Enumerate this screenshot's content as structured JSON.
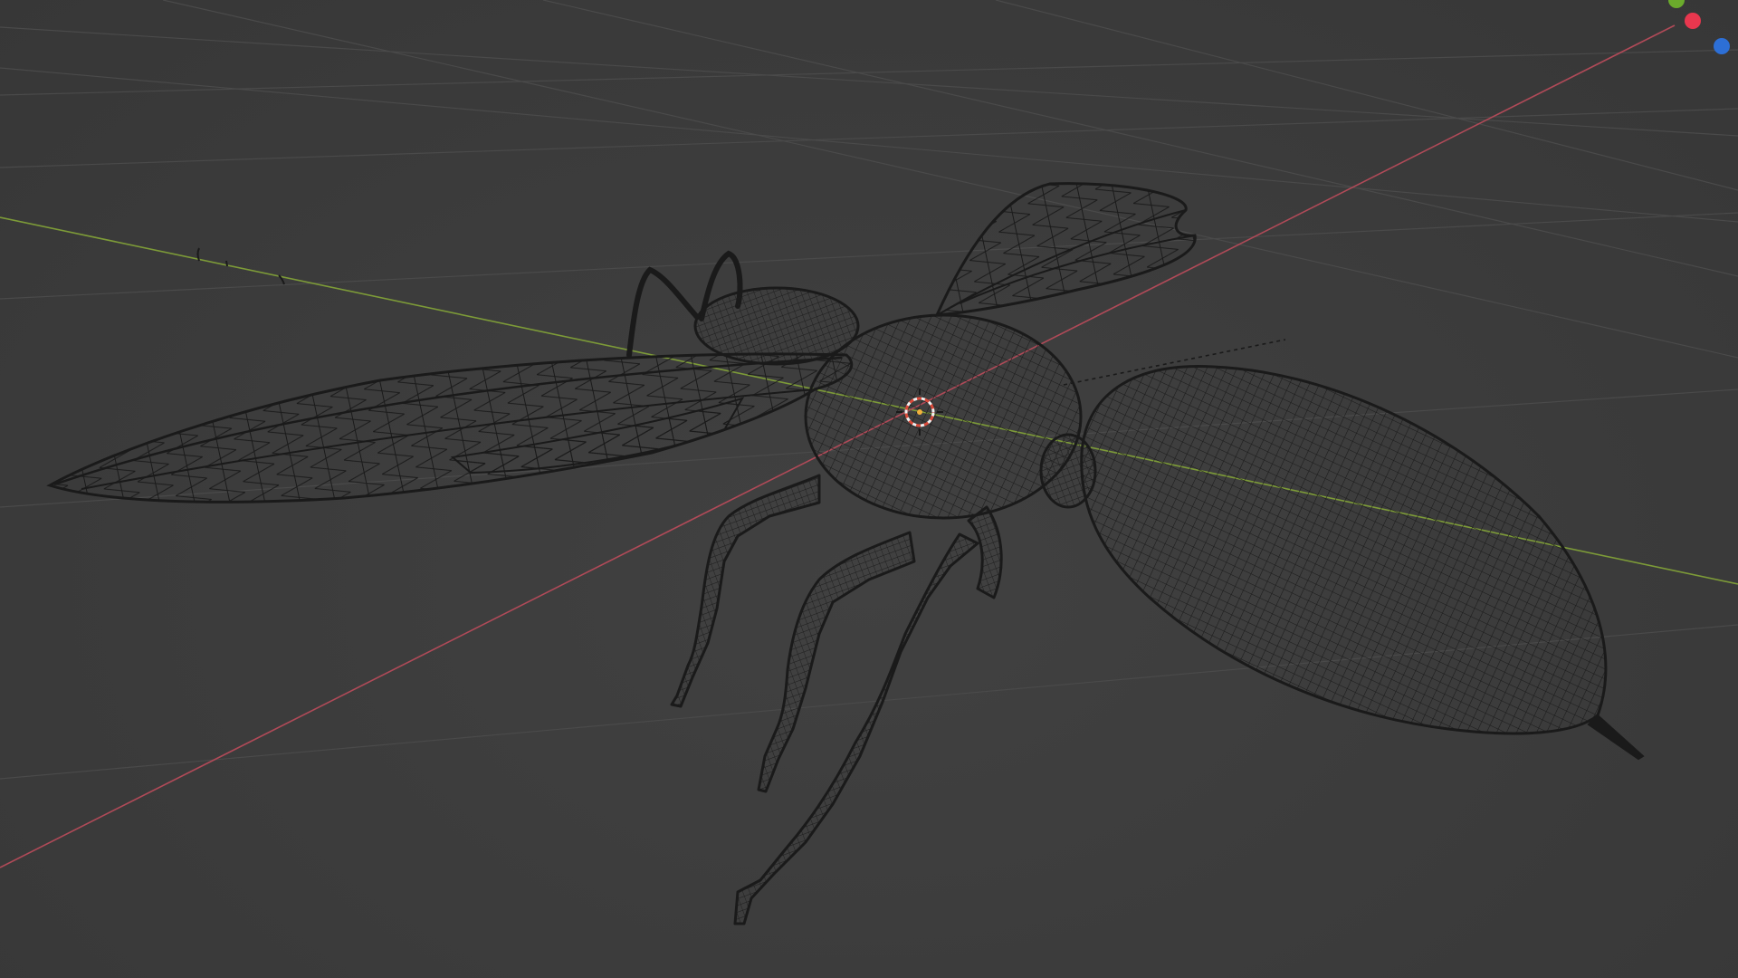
{
  "app": {
    "name": "3D Viewport",
    "shading_mode": "wireframe"
  },
  "colors": {
    "background": "#3d3d3d",
    "grid": "#4a4a4a",
    "axis_x": "#b04a58",
    "axis_y": "#7d9b38",
    "wire": "#1a1a1a",
    "origin_ring_red": "#d94a3a",
    "origin_ring_white": "#f0f0f0",
    "gizmo_x": "#e8374e",
    "gizmo_y": "#6bab2c",
    "gizmo_z": "#2d6fd6"
  },
  "scene": {
    "object": "wasp-model",
    "icons": {
      "origin": "3d-cursor-icon",
      "gizmo": "navigation-gizmo-icon"
    }
  }
}
